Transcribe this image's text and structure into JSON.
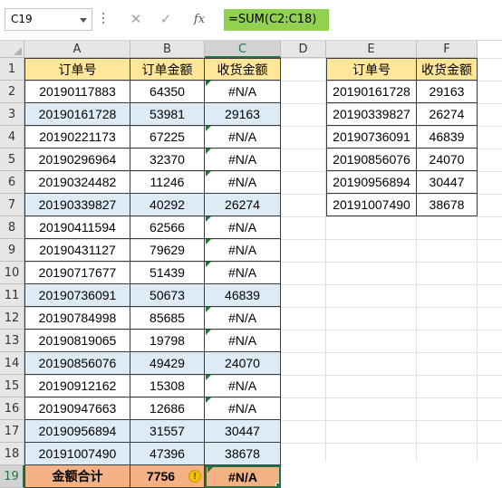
{
  "formula_bar": {
    "name_box": "C19",
    "cancel_glyph": "✕",
    "enter_glyph": "✓",
    "fx_label": "fx",
    "formula": "=SUM(C2:C18)"
  },
  "columns": [
    "A",
    "B",
    "C",
    "D",
    "E",
    "F"
  ],
  "rows": [
    "1",
    "2",
    "3",
    "4",
    "5",
    "6",
    "7",
    "8",
    "9",
    "10",
    "11",
    "12",
    "13",
    "14",
    "15",
    "16",
    "17",
    "18",
    "19"
  ],
  "left_table": {
    "headers": [
      "订单号",
      "订单金额",
      "收货金额"
    ],
    "rows": [
      [
        "20190117883",
        "64350",
        "#N/A"
      ],
      [
        "20190161728",
        "53981",
        "29163"
      ],
      [
        "20190221173",
        "67225",
        "#N/A"
      ],
      [
        "20190296964",
        "32370",
        "#N/A"
      ],
      [
        "20190324482",
        "11246",
        "#N/A"
      ],
      [
        "20190339827",
        "40292",
        "26274"
      ],
      [
        "20190411594",
        "62566",
        "#N/A"
      ],
      [
        "20190431127",
        "79629",
        "#N/A"
      ],
      [
        "20190717677",
        "51439",
        "#N/A"
      ],
      [
        "20190736091",
        "50673",
        "46839"
      ],
      [
        "20190784998",
        "85685",
        "#N/A"
      ],
      [
        "20190819065",
        "19798",
        "#N/A"
      ],
      [
        "20190856076",
        "49429",
        "24070"
      ],
      [
        "20190912162",
        "15308",
        "#N/A"
      ],
      [
        "20190947663",
        "12686",
        "#N/A"
      ],
      [
        "20190956894",
        "31557",
        "30447"
      ],
      [
        "20191007490",
        "47396",
        "38678"
      ]
    ],
    "total": [
      "金额合计",
      "7756",
      "#N/A"
    ]
  },
  "right_table": {
    "headers": [
      "订单号",
      "收货金额"
    ],
    "rows": [
      [
        "20190161728",
        "29163"
      ],
      [
        "20190339827",
        "26274"
      ],
      [
        "20190736091",
        "46839"
      ],
      [
        "20190856076",
        "24070"
      ],
      [
        "20190956894",
        "30447"
      ],
      [
        "20191007490",
        "38678"
      ]
    ]
  },
  "colors": {
    "header_fill": "#ffe699",
    "highlight_fill": "#ddebf7",
    "total_fill": "#f4b183",
    "formula_fill": "#92d050",
    "selection": "#217346"
  }
}
